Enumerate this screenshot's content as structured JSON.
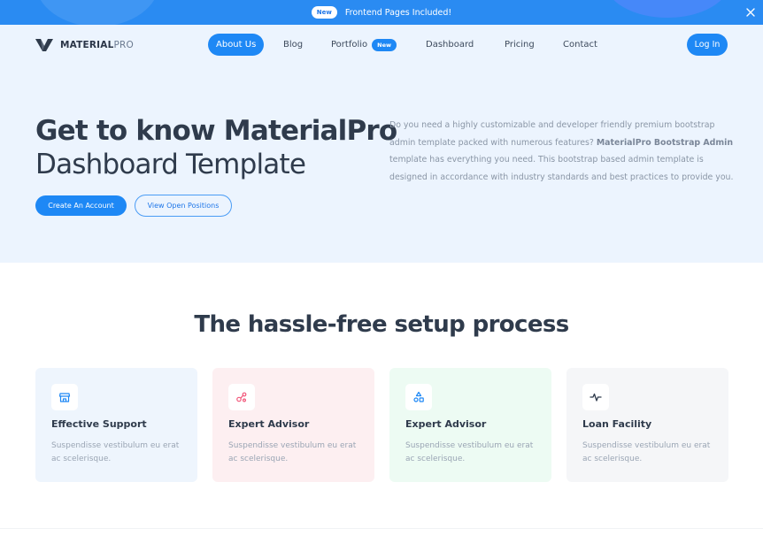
{
  "announcement": {
    "badge": "New",
    "message": "Frontend Pages Included!",
    "close_icon": "close-icon"
  },
  "brand": {
    "name_bold": "MATERIAL",
    "name_light": "PRO",
    "logo_icon": "materialpro-logo"
  },
  "nav": {
    "items": [
      {
        "label": "About Us",
        "active": true
      },
      {
        "label": "Blog"
      },
      {
        "label": "Portfolio",
        "badge": "New"
      },
      {
        "label": "Dashboard"
      },
      {
        "label": "Pricing"
      },
      {
        "label": "Contact"
      }
    ],
    "login_label": "Log In"
  },
  "hero": {
    "headline": "Get to know MaterialPro",
    "subheadline": "Dashboard Template",
    "primary_button": "Create An Account",
    "secondary_button": "View Open Positions",
    "description_part1": "Do you need a highly customizable and developer friendly premium bootstrap admin template packed with numerous features? ",
    "description_bold": "MaterialPro Bootstrap Admin",
    "description_part2": " template has everything you need. This bootstrap based admin template is designed in accordance with industry standards and best practices to provide you."
  },
  "setup": {
    "title": "The hassle-free setup process",
    "cards": [
      {
        "title": "Effective Support",
        "description": "Suspendisse vestibulum eu erat ac scelerisque.",
        "icon": "store-icon",
        "bg": "#eef5fd",
        "icon_color": "#1e88f5"
      },
      {
        "title": "Expert Advisor",
        "description": "Suspendisse vestibulum eu erat ac scelerisque.",
        "icon": "share-nodes-icon",
        "bg": "#fdeff1",
        "icon_color": "#f2577a"
      },
      {
        "title": "Expert Advisor",
        "description": "Suspendisse vestibulum eu erat ac scelerisque.",
        "icon": "shapes-icon",
        "bg": "#edfbf3",
        "icon_color": "#1e88f5"
      },
      {
        "title": "Loan Facility",
        "description": "Suspendisse vestibulum eu erat ac scelerisque.",
        "icon": "activity-icon",
        "bg": "#f5f6f8",
        "icon_color": "#2f3b4c"
      }
    ]
  },
  "colors": {
    "primary": "#1e88f5",
    "topbar": "#2a8bf2",
    "hero_bg": "#ecf4fe",
    "heading": "#2f3b4c"
  }
}
